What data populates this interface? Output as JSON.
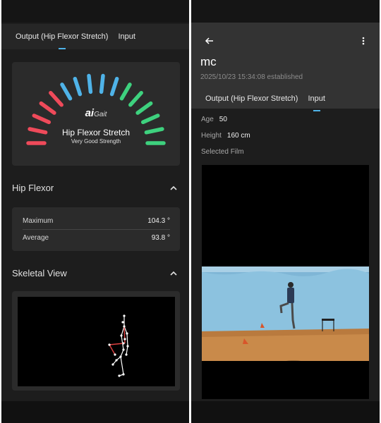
{
  "left": {
    "tabs": [
      {
        "label": "Output (Hip Flexor Stretch)",
        "active": true
      },
      {
        "label": "Input",
        "active": false
      }
    ],
    "gauge": {
      "logo_ai": "ai",
      "logo_gait": "Gait",
      "title": "Hip Flexor Stretch",
      "subtitle": "Very Good Strength",
      "segments_total": 16,
      "colors": {
        "low": "#ef4a5a",
        "mid": "#4fb3e8",
        "high": "#3ed17e"
      }
    },
    "hip_flexor": {
      "header": "Hip Flexor",
      "rows": [
        {
          "label": "Maximum",
          "value": "104.3 °"
        },
        {
          "label": "Average",
          "value": "93.8 °"
        }
      ]
    },
    "skeletal": {
      "header": "Skeletal View"
    }
  },
  "right": {
    "title": "mc",
    "established": "2025/10/23 15:34:08 established",
    "tabs": [
      {
        "label": "Output (Hip Flexor Stretch)",
        "active": false
      },
      {
        "label": "Input",
        "active": true
      }
    ],
    "fields": [
      {
        "label": "Age",
        "value": "50"
      },
      {
        "label": "Height",
        "value": "160 cm"
      }
    ],
    "selected_film_label": "Selected Film"
  },
  "colors": {
    "background": "#1d1d1d",
    "card": "#2b2b2b",
    "accent": "#4fb3e8"
  }
}
